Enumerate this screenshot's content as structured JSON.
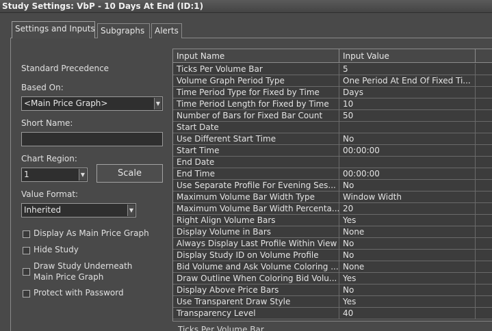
{
  "window": {
    "title": "Study Settings: VbP - 10 Days At End (ID:1)"
  },
  "tabs": [
    {
      "label": "Settings and Inputs",
      "active": true
    },
    {
      "label": "Subgraphs",
      "active": false
    },
    {
      "label": "Alerts",
      "active": false
    }
  ],
  "settings": {
    "standard_precedence": "Standard Precedence",
    "based_on_label": "Based On:",
    "based_on_value": "<Main Price Graph>",
    "short_name_label": "Short Name:",
    "short_name_value": "",
    "chart_region_label": "Chart Region:",
    "chart_region_value": "1",
    "scale_button": "Scale",
    "value_format_label": "Value Format:",
    "value_format_value": "Inherited",
    "checkboxes": [
      {
        "label": "Display As Main Price Graph",
        "checked": false
      },
      {
        "label": "Hide Study",
        "checked": false
      },
      {
        "label": "Draw Study Underneath",
        "label2": "Main Price Graph",
        "checked": false
      },
      {
        "label": "Protect with Password",
        "checked": false
      }
    ]
  },
  "inputs_table": {
    "headers": [
      "Input Name",
      "Input Value"
    ],
    "rows": [
      {
        "name": "Ticks Per Volume Bar",
        "value": "5"
      },
      {
        "name": "Volume Graph Period Type",
        "value": "One Period At End Of Fixed Ti..."
      },
      {
        "name": "Time Period Type for Fixed by Time",
        "value": "Days"
      },
      {
        "name": "Time Period Length for Fixed by Time",
        "value": "10"
      },
      {
        "name": "Number of Bars for Fixed Bar Count",
        "value": "50"
      },
      {
        "name": "Start Date",
        "value": ""
      },
      {
        "name": "Use Different Start Time",
        "value": "No"
      },
      {
        "name": "Start Time",
        "value": "00:00:00"
      },
      {
        "name": "End Date",
        "value": ""
      },
      {
        "name": "End Time",
        "value": "00:00:00"
      },
      {
        "name": "Use Separate Profile For Evening Ses...",
        "value": "No"
      },
      {
        "name": "Maximum Volume Bar Width Type",
        "value": "Window Width"
      },
      {
        "name": "Maximum Volume Bar Width Percenta...",
        "value": "20"
      },
      {
        "name": "Right Align Volume Bars",
        "value": "Yes"
      },
      {
        "name": "Display Volume in Bars",
        "value": "None"
      },
      {
        "name": "Always Display Last Profile Within View",
        "value": "No"
      },
      {
        "name": "Display Study ID on Volume Profile",
        "value": "No"
      },
      {
        "name": "Bid Volume and Ask Volume Coloring ...",
        "value": "None"
      },
      {
        "name": "Draw Outline When Coloring Bid Volu...",
        "value": "Yes"
      },
      {
        "name": "Display Above Price Bars",
        "value": "No"
      },
      {
        "name": "Use Transparent Draw Style",
        "value": "Yes"
      },
      {
        "name": "Transparency Level",
        "value": "40"
      }
    ]
  },
  "selected_input_caption": "Ticks Per Volume Bar"
}
